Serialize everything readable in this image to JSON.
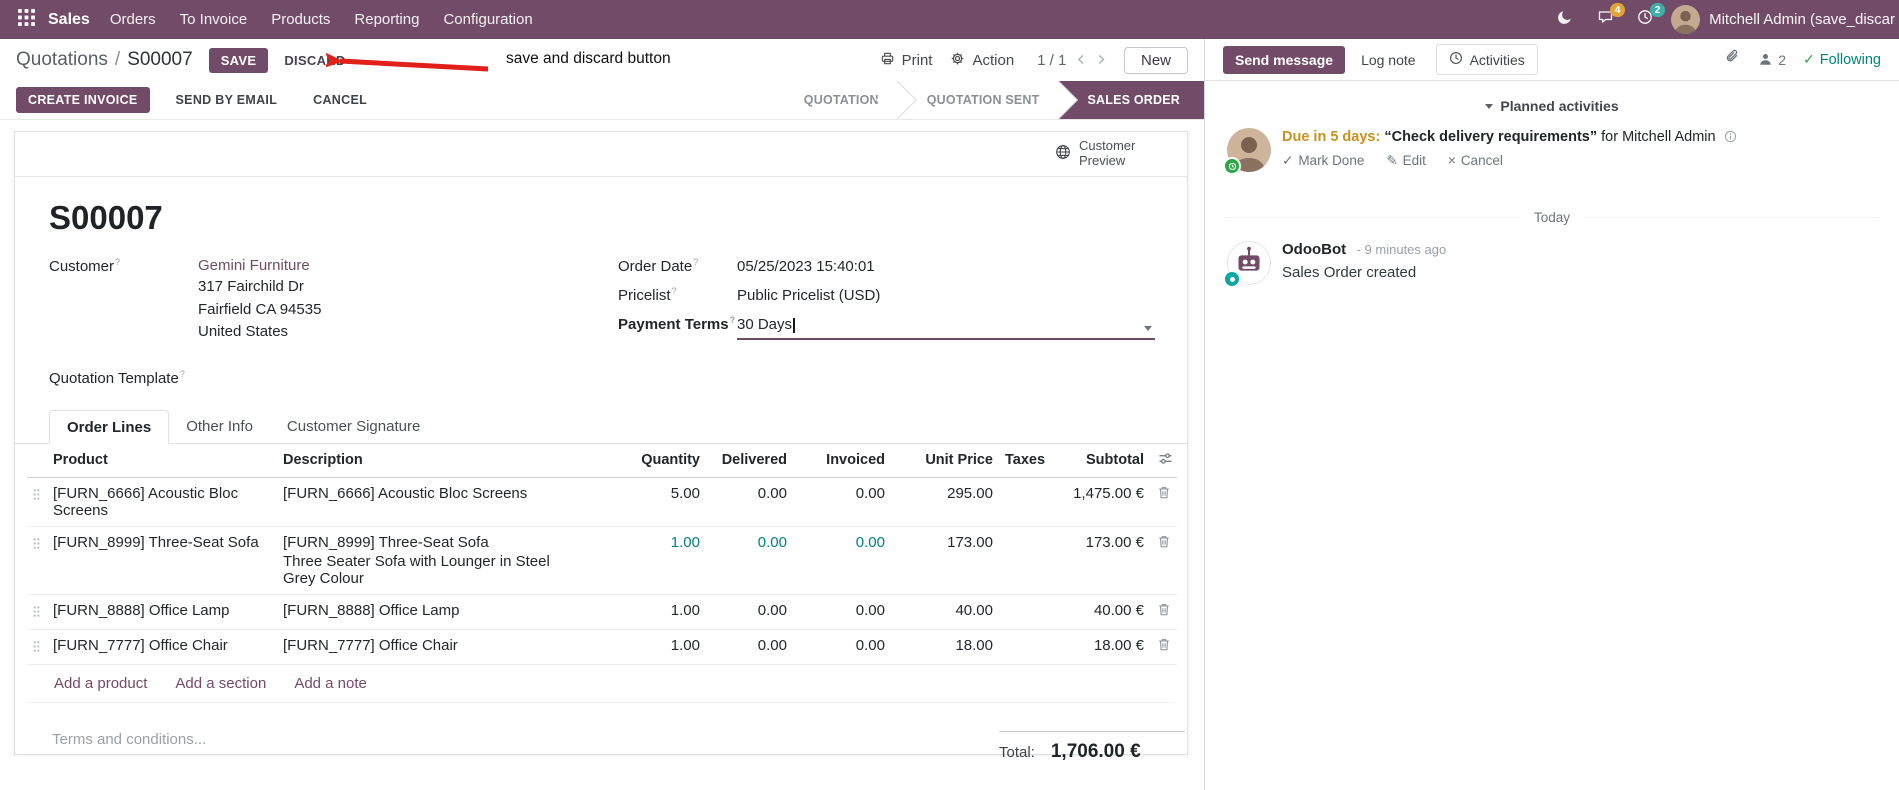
{
  "colors": {
    "brand": "#714B67",
    "navbar_bg": "#714B67",
    "active_stage_bg": "#714B67",
    "edited_value_teal": "#017e84",
    "annotation_red": "#e02019",
    "messages_badge": "#e2a33b",
    "activities_badge": "#3cb1a7",
    "following_green": "#28a745",
    "due_amber": "#c7921e"
  },
  "icons": {
    "apps_grid": "3x3-dot-grid",
    "moon": "crescent",
    "messages": "chat-bubble",
    "activities_clock": "clock",
    "print": "printer",
    "action": "gear",
    "pager_prev": "‹",
    "pager_next": "›",
    "globe": "globe",
    "drag_handle": "6-dot-grid",
    "delete": "trash-can",
    "optional_columns": "sliders",
    "dropdown_caret": "▾",
    "attachment": "paperclip",
    "followers": "person",
    "following_check": "✓",
    "mark_done": "✓",
    "edit": "✎",
    "cancel_x": "×",
    "info": "circled-i",
    "collapse_caret": "▾"
  },
  "navbar": {
    "app_name": "Sales",
    "menus": [
      "Orders",
      "To Invoice",
      "Products",
      "Reporting",
      "Configuration"
    ],
    "messages_badge": "4",
    "activities_badge": "2",
    "user_name": "Mitchell Admin (save_discar"
  },
  "breadcrumb": {
    "parent": "Quotations",
    "separator": "/",
    "current": "S00007",
    "save": "SAVE",
    "discard": "DISCARD",
    "annotation": "save and discard button",
    "print": "Print",
    "action": "Action",
    "pager": "1 / 1",
    "new": "New"
  },
  "statusbar": {
    "create_invoice": "CREATE INVOICE",
    "send_by_email": "SEND BY EMAIL",
    "cancel": "CANCEL",
    "stages": [
      {
        "label": "QUOTATION",
        "active": false
      },
      {
        "label": "QUOTATION SENT",
        "active": false
      },
      {
        "label": "SALES ORDER",
        "active": true
      }
    ]
  },
  "sheet": {
    "customer_preview": "Customer Preview",
    "title": "S00007",
    "help_marker": "?",
    "fields": {
      "customer_label": "Customer",
      "customer_name": "Gemini Furniture",
      "address_line1": "317 Fairchild Dr",
      "address_line2": "Fairfield CA 94535",
      "address_line3": "United States",
      "quotation_template_label": "Quotation Template",
      "order_date_label": "Order Date",
      "order_date_value": "05/25/2023 15:40:01",
      "pricelist_label": "Pricelist",
      "pricelist_value": "Public Pricelist (USD)",
      "payment_terms_label": "Payment Terms",
      "payment_terms_value": "30 Days"
    },
    "tabs": [
      {
        "label": "Order Lines",
        "active": true
      },
      {
        "label": "Other Info",
        "active": false
      },
      {
        "label": "Customer Signature",
        "active": false
      }
    ],
    "table": {
      "headers": {
        "product": "Product",
        "description": "Description",
        "quantity": "Quantity",
        "delivered": "Delivered",
        "invoiced": "Invoiced",
        "unit_price": "Unit Price",
        "taxes": "Taxes",
        "subtotal": "Subtotal"
      },
      "rows": [
        {
          "product": "[FURN_6666] Acoustic Bloc Screens",
          "description": "[FURN_6666] Acoustic Bloc Screens",
          "description2": "",
          "quantity": "5.00",
          "delivered": "0.00",
          "invoiced": "0.00",
          "unit_price": "295.00",
          "taxes": "",
          "subtotal": "1,475.00 €"
        },
        {
          "product": "[FURN_8999] Three-Seat Sofa",
          "description": "[FURN_8999] Three-Seat Sofa",
          "description2": "Three Seater Sofa with Lounger in Steel Grey Colour",
          "quantity": "1.00",
          "delivered": "0.00",
          "invoiced": "0.00",
          "unit_price": "173.00",
          "taxes": "",
          "subtotal": "173.00 €"
        },
        {
          "product": "[FURN_8888] Office Lamp",
          "description": "[FURN_8888] Office Lamp",
          "description2": "",
          "quantity": "1.00",
          "delivered": "0.00",
          "invoiced": "0.00",
          "unit_price": "40.00",
          "taxes": "",
          "subtotal": "40.00 €"
        },
        {
          "product": "[FURN_7777] Office Chair",
          "description": "[FURN_7777] Office Chair",
          "description2": "",
          "quantity": "1.00",
          "delivered": "0.00",
          "invoiced": "0.00",
          "unit_price": "18.00",
          "taxes": "",
          "subtotal": "18.00 €"
        }
      ],
      "add_product": "Add a product",
      "add_section": "Add a section",
      "add_note": "Add a note"
    },
    "terms_placeholder": "Terms and conditions...",
    "total_label": "Total:",
    "total_value": "1,706.00 €"
  },
  "chatter": {
    "send_message": "Send message",
    "log_note": "Log note",
    "activities_tab": "Activities",
    "followers_count": "2",
    "following": "Following",
    "planned_activities": "Planned activities",
    "activity": {
      "due": "Due in 5 days:",
      "summary": "“Check delivery requirements”",
      "assigned": "for Mitchell Admin",
      "mark_done": "Mark Done",
      "edit": "Edit",
      "cancel": "Cancel"
    },
    "date_divider": "Today",
    "message": {
      "author": "OdooBot",
      "time": "- 9 minutes ago",
      "body": "Sales Order created"
    }
  }
}
